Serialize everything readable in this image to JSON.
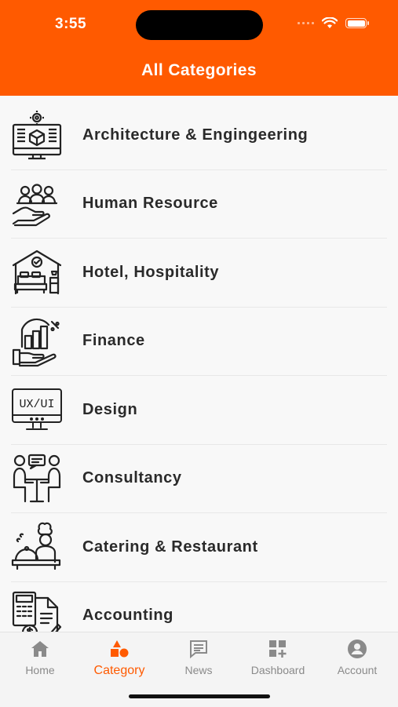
{
  "status_bar": {
    "time": "3:55"
  },
  "header": {
    "title": "All Categories"
  },
  "categories": [
    {
      "label": "Architecture & Engingeering",
      "icon": "architecture-icon"
    },
    {
      "label": "Human Resource",
      "icon": "human-resource-icon"
    },
    {
      "label": "Hotel, Hospitality",
      "icon": "hotel-icon"
    },
    {
      "label": "Finance",
      "icon": "finance-icon"
    },
    {
      "label": "Design",
      "icon": "design-icon",
      "icon_text": "UX/UI"
    },
    {
      "label": "Consultancy",
      "icon": "consultancy-icon"
    },
    {
      "label": "Catering & Restaurant",
      "icon": "catering-icon"
    },
    {
      "label": "Accounting",
      "icon": "accounting-icon"
    }
  ],
  "tabbar": {
    "active": "Category",
    "accent": "#ff5a00",
    "tabs": [
      {
        "label": "Home",
        "icon": "home-icon"
      },
      {
        "label": "Category",
        "icon": "category-icon"
      },
      {
        "label": "News",
        "icon": "news-icon"
      },
      {
        "label": "Dashboard",
        "icon": "dashboard-icon"
      },
      {
        "label": "Account",
        "icon": "account-icon"
      }
    ]
  }
}
